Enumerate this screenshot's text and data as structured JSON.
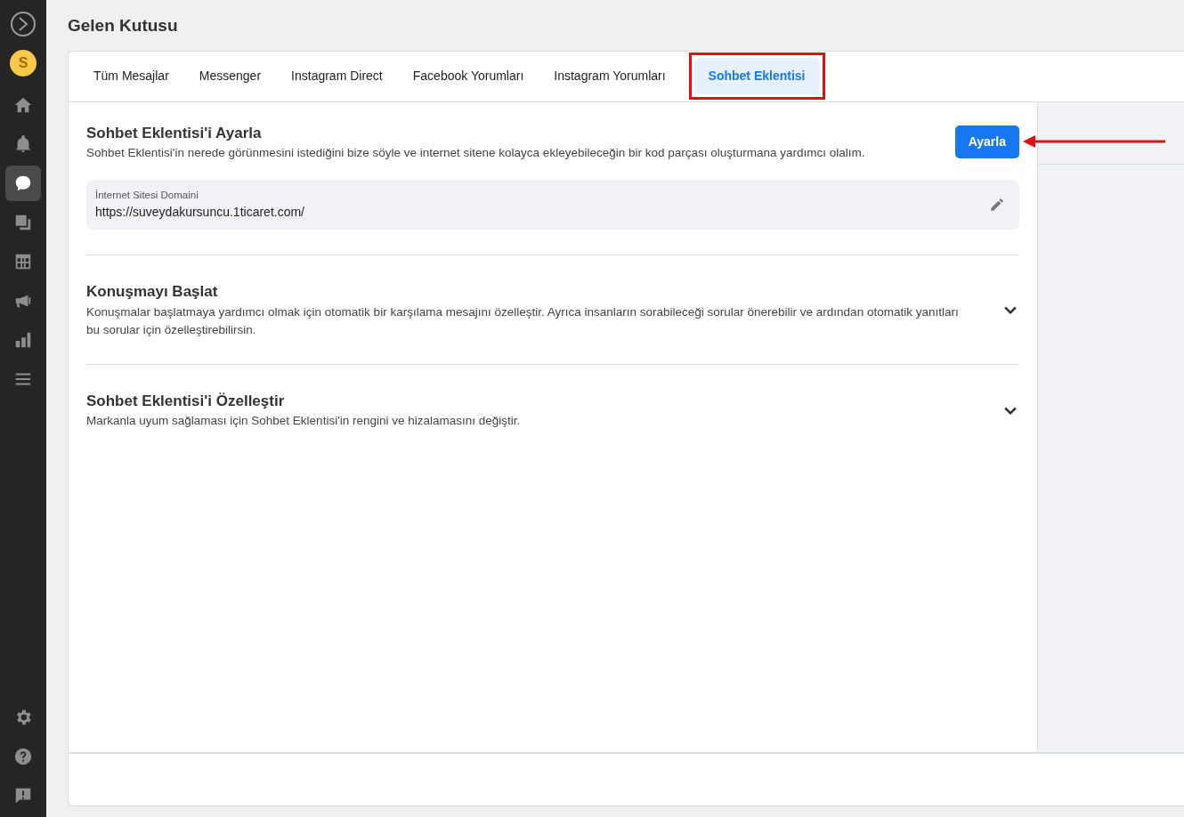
{
  "sidebar": {
    "avatar": "S",
    "items": [
      {
        "kind": "home",
        "selected": false
      },
      {
        "kind": "bell",
        "selected": false
      },
      {
        "kind": "chat",
        "selected": true
      },
      {
        "kind": "pages",
        "selected": false
      },
      {
        "kind": "table",
        "selected": false
      },
      {
        "kind": "megaphone",
        "selected": false
      },
      {
        "kind": "chart",
        "selected": false
      },
      {
        "kind": "menu",
        "selected": false
      }
    ],
    "bottom_items": [
      {
        "kind": "gear"
      },
      {
        "kind": "help"
      },
      {
        "kind": "feedback"
      }
    ]
  },
  "page_title": "Gelen Kutusu",
  "tabs": [
    {
      "label": "Tüm Mesajlar",
      "selected": false
    },
    {
      "label": "Messenger",
      "selected": false
    },
    {
      "label": "Instagram Direct",
      "selected": false
    },
    {
      "label": "Facebook Yorumları",
      "selected": false
    },
    {
      "label": "Instagram Yorumları",
      "selected": false
    },
    {
      "label": "Sohbet Eklentisi",
      "selected": true
    }
  ],
  "setup": {
    "title": "Sohbet Eklentisi'i Ayarla",
    "description": "Sohbet Eklentisi'in nerede görünmesini istediğini bize söyle ve internet sitene kolayca ekleyebileceğin bir kod parçası oluşturmana yardımcı olalım.",
    "button": "Ayarla",
    "domain_label": "İnternet Sitesi Domaini",
    "domain_value": "https://suveydakursuncu.1ticaret.com/"
  },
  "sections": [
    {
      "title": "Konuşmayı Başlat",
      "description": "Konuşmalar başlatmaya yardımcı olmak için otomatik bir karşılama mesajını özelleştir. Ayrıca insanların sorabileceği sorular önerebilir ve ardından otomatik yanıtları bu sorular için özelleştirebilirsin.",
      "expanded": false
    },
    {
      "title": "Sohbet Eklentisi'i Özelleştir",
      "description": "Markanla uyum sağlaması için Sohbet Eklentisi'in rengini ve hizalamasını değiştir.",
      "expanded": false
    }
  ]
}
